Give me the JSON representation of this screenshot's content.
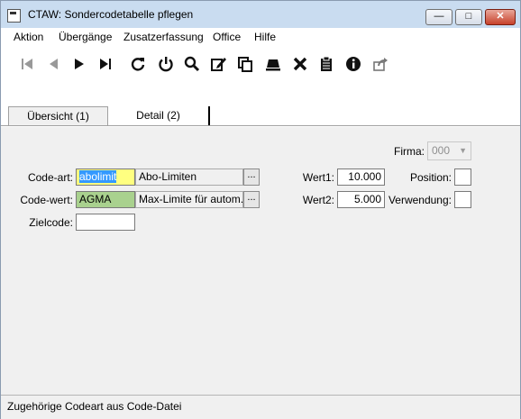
{
  "window": {
    "title": "CTAW: Sondercodetabelle pflegen",
    "minimize_icon": "minimize-icon",
    "maximize_icon": "maximize-icon",
    "close_icon": "close-icon"
  },
  "menu": {
    "items": [
      "Aktion",
      "Übergänge",
      "Zusatzerfassung",
      "Office",
      "Hilfe"
    ]
  },
  "toolbar": {
    "icons": [
      "first-record-icon",
      "previous-icon",
      "next-icon",
      "last-record-icon",
      "refresh-icon",
      "power-icon",
      "search-icon",
      "edit-icon",
      "copy-icon",
      "stack-icon",
      "delete-icon",
      "clipboard-icon",
      "info-icon",
      "export-icon"
    ]
  },
  "tabs": [
    {
      "label": "Übersicht (1)",
      "active": false
    },
    {
      "label": "Detail (2)",
      "active": true
    }
  ],
  "form": {
    "firma": {
      "label": "Firma:",
      "value": "000"
    },
    "code_art": {
      "label": "Code-art:",
      "value": "abolimit",
      "description": "Abo-Limiten",
      "ellipsis": "..."
    },
    "code_wert": {
      "label": "Code-wert:",
      "value": "AGMA",
      "description": "Max-Limite für autom. Au",
      "ellipsis": "..."
    },
    "zielcode": {
      "label": "Zielcode:",
      "value": ""
    },
    "wert1": {
      "label": "Wert1:",
      "value": "10.000"
    },
    "wert2": {
      "label": "Wert2:",
      "value": "5.000"
    },
    "position": {
      "label": "Position:",
      "value": ""
    },
    "verwendung": {
      "label": "Verwendung:",
      "value": ""
    }
  },
  "colors": {
    "code_art_highlight": "#ffff80",
    "selection": "#3399ff",
    "code_wert_fill": "#a9d18e",
    "titlebar": "#c9dcf0"
  },
  "status": {
    "text": "Zugehörige Codeart aus Code-Datei"
  }
}
